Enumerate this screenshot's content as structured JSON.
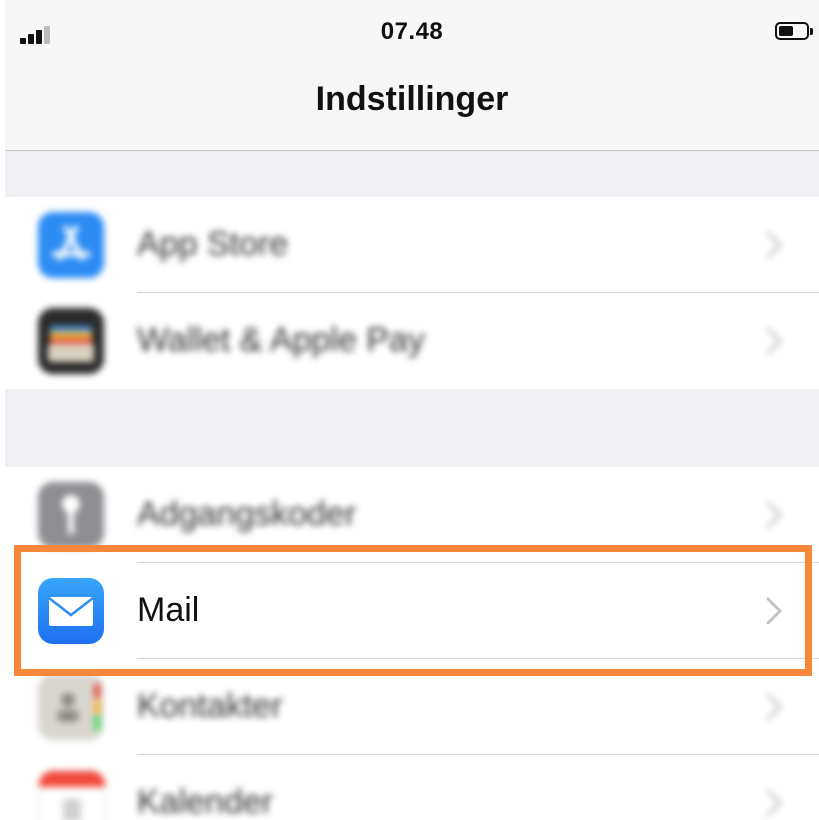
{
  "status_bar": {
    "time": "07.48"
  },
  "nav": {
    "title": "Indstillinger"
  },
  "rows": [
    {
      "label": "App Store",
      "icon": "app-store-icon"
    },
    {
      "label": "Wallet & Apple Pay",
      "icon": "wallet-icon"
    },
    {
      "label": "Adgangskoder",
      "icon": "key-icon"
    },
    {
      "label": "Mail",
      "icon": "mail-icon"
    },
    {
      "label": "Kontakter",
      "icon": "contacts-icon"
    },
    {
      "label": "Kalender",
      "icon": "calendar-icon"
    }
  ],
  "colors": {
    "highlight": "#f7883a",
    "mail_icon": "#1e8df5",
    "app_store_icon": "#2b8cf3"
  }
}
